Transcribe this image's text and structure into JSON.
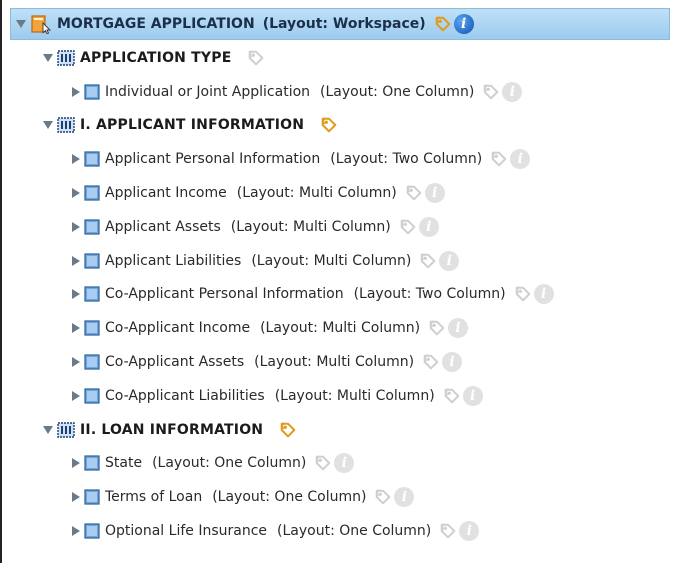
{
  "root": {
    "label": "MORTGAGE APPLICATION",
    "layout": "(Layout: Workspace)"
  },
  "sections": [
    {
      "label": "APPLICATION TYPE",
      "items": [
        {
          "label": "Individual or Joint Application",
          "layout": "(Layout: One Column)"
        }
      ]
    },
    {
      "label": "I.  APPLICANT INFORMATION",
      "items": [
        {
          "label": "Applicant Personal Information",
          "layout": "(Layout: Two Column)"
        },
        {
          "label": "Applicant Income",
          "layout": "(Layout: Multi Column)"
        },
        {
          "label": "Applicant Assets",
          "layout": "(Layout: Multi Column)"
        },
        {
          "label": "Applicant Liabilities",
          "layout": "(Layout: Multi Column)"
        },
        {
          "label": "Co-Applicant Personal Information",
          "layout": "(Layout: Two Column)"
        },
        {
          "label": "Co-Applicant Income",
          "layout": "(Layout: Multi Column)"
        },
        {
          "label": "Co-Applicant Assets",
          "layout": "(Layout: Multi Column)"
        },
        {
          "label": "Co-Applicant Liabilities",
          "layout": "(Layout: Multi Column)"
        }
      ]
    },
    {
      "label": "II.  LOAN INFORMATION",
      "items": [
        {
          "label": "State",
          "layout": "(Layout: One Column)"
        },
        {
          "label": "Terms of Loan",
          "layout": "(Layout: One Column)"
        },
        {
          "label": "Optional Life Insurance",
          "layout": "(Layout: One Column)"
        }
      ]
    }
  ],
  "icons": {
    "expanded": "triangle-down-icon",
    "collapsed": "triangle-right-icon",
    "root": "folder-application-icon",
    "section": "section-grid-icon",
    "page": "page-form-icon",
    "tag": "tag-icon",
    "info": "info-icon"
  },
  "colors": {
    "root_bar": "#a9d3f3",
    "tag_active": "#e09a1c",
    "tag_dim": "#cfcfcf",
    "info_active": "#1a63c9",
    "info_dim": "#dcdcdc"
  }
}
